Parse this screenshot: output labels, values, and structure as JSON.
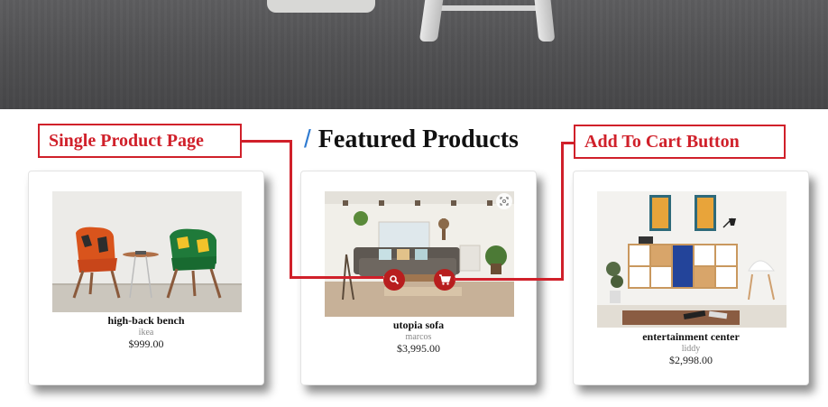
{
  "section": {
    "slash": "/",
    "title": "Featured Products"
  },
  "annotations": {
    "single_product": "Single Product Page",
    "add_to_cart": "Add To Cart Button"
  },
  "products": [
    {
      "name": "high-back bench",
      "company": "ikea",
      "price": "$999.00"
    },
    {
      "name": "utopia sofa",
      "company": "marcos",
      "price": "$3,995.00"
    },
    {
      "name": "entertainment center",
      "company": "liddy",
      "price": "$2,998.00"
    }
  ],
  "icons": {
    "view": "search-icon",
    "cart": "cart-icon",
    "fullscreen": "expand-icon"
  },
  "colors": {
    "accent": "#2f7bd1",
    "annotation": "#d0202a",
    "button": "#b81e1e"
  }
}
